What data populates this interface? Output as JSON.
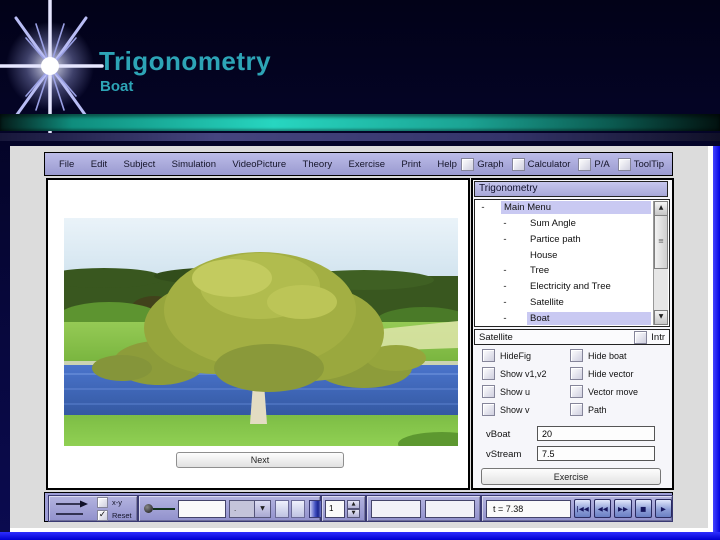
{
  "slide": {
    "title": "Trigonometry",
    "subtitle": "Boat",
    "accent_teal": "#2da4b6",
    "accent_blue": "#0a0adf"
  },
  "app": {
    "menu": {
      "items": [
        "File",
        "Edit",
        "Subject",
        "Simulation",
        "VideoPicture",
        "Theory",
        "Exercise",
        "Print",
        "Help"
      ],
      "toggles": [
        "Graph",
        "Calculator",
        "P/A",
        "ToolTip"
      ]
    },
    "panel": {
      "title": "Trigonometry",
      "tree": [
        {
          "dash": "-",
          "label": "Main Menu"
        },
        {
          "dash": "-",
          "label": "Sum Angle"
        },
        {
          "dash": "-",
          "label": "Partice path"
        },
        {
          "dash": "",
          "label": "House"
        },
        {
          "dash": "-",
          "label": "Tree"
        },
        {
          "dash": "-",
          "label": "Electricity and Tree"
        },
        {
          "dash": "-",
          "label": "Satellite"
        },
        {
          "dash": "-",
          "label": "Boat"
        }
      ],
      "section": {
        "title": "Satellite",
        "corner_toggle": "Intr"
      },
      "checkboxes_left": [
        "HideFig",
        "Show v1,v2",
        "Show u",
        "Show v"
      ],
      "checkboxes_right": [
        "Hide boat",
        "Hide vector",
        "Vector move",
        "Path"
      ],
      "fields": [
        {
          "label": "vBoat",
          "value": "20"
        },
        {
          "label": "vStream",
          "value": "7.5"
        }
      ],
      "exercise_button": "Exercise"
    },
    "viewer": {
      "next_button": "Next"
    },
    "toolbar": {
      "xy_label": "x-y",
      "reset_label": "Reset",
      "dropdown_value": ".",
      "spinner_value": "1",
      "time_display": "t = 7.38",
      "playback": [
        "|◀◀",
        "◀◀",
        "▶▶",
        "■",
        "▶"
      ]
    }
  },
  "icons": {
    "up": "▲",
    "down": "▼",
    "check": "✓",
    "grip": "≡"
  }
}
